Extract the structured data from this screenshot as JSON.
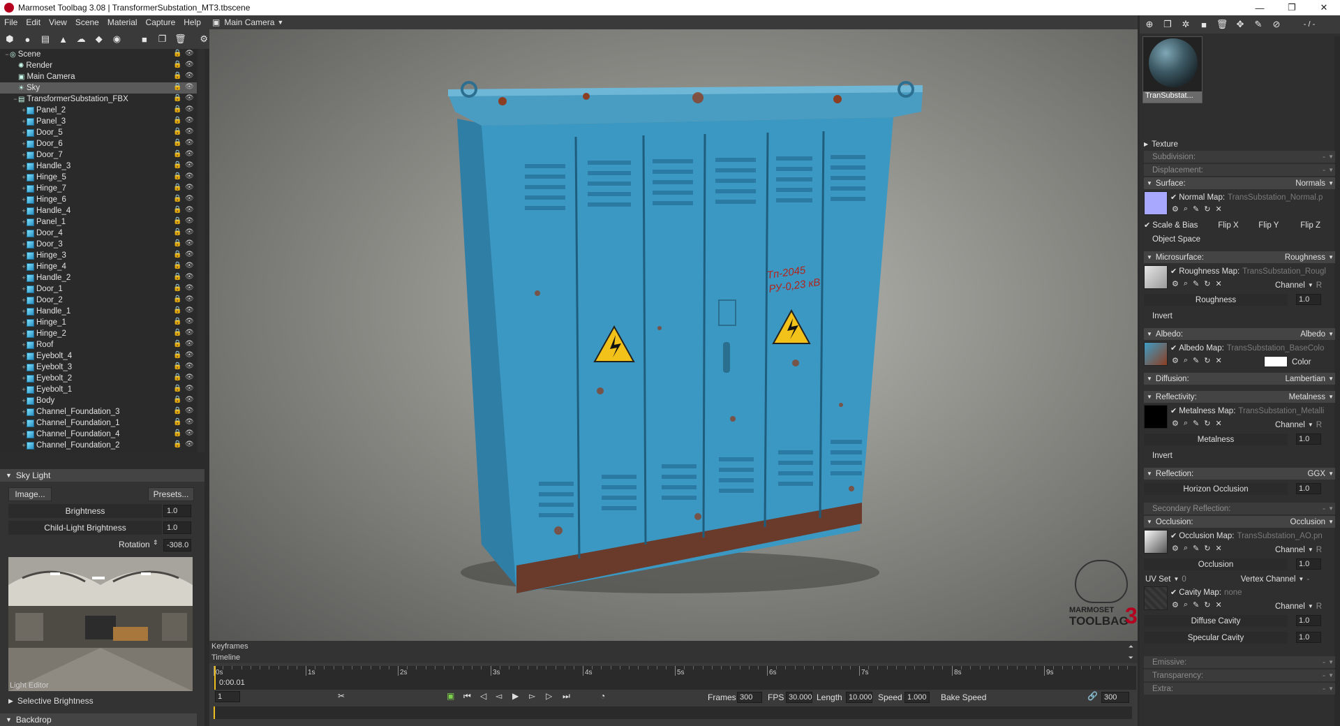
{
  "window": {
    "title": "Marmoset Toolbag 3.08  |  TransformerSubstation_MT3.tbscene",
    "controls": {
      "minimize": "—",
      "maximize": "❐",
      "close": "✕"
    }
  },
  "menu": [
    "File",
    "Edit",
    "View",
    "Scene",
    "Material",
    "Capture",
    "Help"
  ],
  "camera": {
    "label": "Main Camera"
  },
  "scene_tree": {
    "items": [
      {
        "label": "Scene",
        "indent": 0,
        "icon": "scene-icon",
        "expander": "−"
      },
      {
        "label": "Render",
        "indent": 1,
        "icon": "render-icon",
        "expander": ""
      },
      {
        "label": "Main Camera",
        "indent": 1,
        "icon": "camera-icon",
        "expander": ""
      },
      {
        "label": "Sky",
        "indent": 1,
        "icon": "sky-icon",
        "expander": "",
        "selected": true
      },
      {
        "label": "TransformerSubstation_FBX",
        "indent": 1,
        "icon": "file-icon",
        "expander": "−"
      },
      {
        "label": "Panel_2",
        "indent": 2,
        "icon": "mesh-icon",
        "expander": "+"
      },
      {
        "label": "Panel_3",
        "indent": 2,
        "icon": "mesh-icon",
        "expander": "+"
      },
      {
        "label": "Door_5",
        "indent": 2,
        "icon": "mesh-icon",
        "expander": "+"
      },
      {
        "label": "Door_6",
        "indent": 2,
        "icon": "mesh-icon",
        "expander": "+"
      },
      {
        "label": "Door_7",
        "indent": 2,
        "icon": "mesh-icon",
        "expander": "+"
      },
      {
        "label": "Handle_3",
        "indent": 2,
        "icon": "mesh-icon",
        "expander": "+"
      },
      {
        "label": "Hinge_5",
        "indent": 2,
        "icon": "mesh-icon",
        "expander": "+"
      },
      {
        "label": "Hinge_7",
        "indent": 2,
        "icon": "mesh-icon",
        "expander": "+"
      },
      {
        "label": "Hinge_6",
        "indent": 2,
        "icon": "mesh-icon",
        "expander": "+"
      },
      {
        "label": "Handle_4",
        "indent": 2,
        "icon": "mesh-icon",
        "expander": "+"
      },
      {
        "label": "Panel_1",
        "indent": 2,
        "icon": "mesh-icon",
        "expander": "+"
      },
      {
        "label": "Door_4",
        "indent": 2,
        "icon": "mesh-icon",
        "expander": "+"
      },
      {
        "label": "Door_3",
        "indent": 2,
        "icon": "mesh-icon",
        "expander": "+"
      },
      {
        "label": "Hinge_3",
        "indent": 2,
        "icon": "mesh-icon",
        "expander": "+"
      },
      {
        "label": "Hinge_4",
        "indent": 2,
        "icon": "mesh-icon",
        "expander": "+"
      },
      {
        "label": "Handle_2",
        "indent": 2,
        "icon": "mesh-icon",
        "expander": "+"
      },
      {
        "label": "Door_1",
        "indent": 2,
        "icon": "mesh-icon",
        "expander": "+"
      },
      {
        "label": "Door_2",
        "indent": 2,
        "icon": "mesh-icon",
        "expander": "+"
      },
      {
        "label": "Handle_1",
        "indent": 2,
        "icon": "mesh-icon",
        "expander": "+"
      },
      {
        "label": "Hinge_1",
        "indent": 2,
        "icon": "mesh-icon",
        "expander": "+"
      },
      {
        "label": "Hinge_2",
        "indent": 2,
        "icon": "mesh-icon",
        "expander": "+"
      },
      {
        "label": "Roof",
        "indent": 2,
        "icon": "mesh-icon",
        "expander": "+"
      },
      {
        "label": "Eyebolt_4",
        "indent": 2,
        "icon": "mesh-icon",
        "expander": "+"
      },
      {
        "label": "Eyebolt_3",
        "indent": 2,
        "icon": "mesh-icon",
        "expander": "+"
      },
      {
        "label": "Eyebolt_2",
        "indent": 2,
        "icon": "mesh-icon",
        "expander": "+"
      },
      {
        "label": "Eyebolt_1",
        "indent": 2,
        "icon": "mesh-icon",
        "expander": "+"
      },
      {
        "label": "Body",
        "indent": 2,
        "icon": "mesh-icon",
        "expander": "+"
      },
      {
        "label": "Channel_Foundation_3",
        "indent": 2,
        "icon": "mesh-icon",
        "expander": "+"
      },
      {
        "label": "Channel_Foundation_1",
        "indent": 2,
        "icon": "mesh-icon",
        "expander": "+"
      },
      {
        "label": "Channel_Foundation_4",
        "indent": 2,
        "icon": "mesh-icon",
        "expander": "+"
      },
      {
        "label": "Channel_Foundation_2",
        "indent": 2,
        "icon": "mesh-icon",
        "expander": "+"
      }
    ]
  },
  "light_editor": {
    "section_title": "Sky Light",
    "image_button": "Image...",
    "presets_button": "Presets...",
    "brightness_label": "Brightness",
    "brightness_value": "1.0",
    "child_brightness_label": "Child-Light Brightness",
    "child_brightness_value": "1.0",
    "rotation_label": "Rotation",
    "rotation_value": "-308.0",
    "preview_caption": "Light Editor",
    "selective_brightness": "Selective Brightness",
    "backdrop": "Backdrop"
  },
  "viewport": {
    "signage_line1": "Tп-2045",
    "signage_line2": "РУ-0,23 кВ",
    "watermark_line1": "MARMOSET",
    "watermark_line2": "TOOLBAG",
    "watermark_number": "3"
  },
  "timeline": {
    "keyframes_label": "Keyframes",
    "timeline_label": "Timeline",
    "current_time": "0:00.01",
    "ticks": [
      "0s",
      "1s",
      "2s",
      "3s",
      "4s",
      "5s",
      "6s",
      "7s",
      "8s",
      "9s"
    ],
    "current_frame": "1",
    "frames_label": "Frames",
    "frames_value": "300",
    "fps_label": "FPS",
    "fps_value": "30.000",
    "length_label": "Length",
    "length_value": "10.000",
    "speed_label": "Speed",
    "speed_value": "1.000",
    "bake_speed": "Bake Speed",
    "end_frame": "300"
  },
  "material": {
    "name": "TranSubstat...",
    "texture": "Texture",
    "subdivision": "Subdivision:",
    "displacement": "Displacement:",
    "dash": "-",
    "surface": {
      "label": "Surface:",
      "mode": "Normals",
      "map_label": "Normal Map:",
      "map_name": "TransSubstation_Normal.p",
      "scale_bias": "Scale & Bias",
      "flip_x": "Flip X",
      "flip_y": "Flip Y",
      "flip_z": "Flip Z",
      "object_space": "Object Space"
    },
    "microsurface": {
      "label": "Microsurface:",
      "mode": "Roughness",
      "map_label": "Roughness Map:",
      "map_name": "TransSubstation_Rougl",
      "channel_label": "Channel",
      "channel": "R",
      "slider_label": "Roughness",
      "slider_value": "1.0",
      "invert": "Invert"
    },
    "albedo": {
      "label": "Albedo:",
      "mode": "Albedo",
      "map_label": "Albedo Map:",
      "map_name": "TransSubstation_BaseColo",
      "color_label": "Color"
    },
    "diffusion": {
      "label": "Diffusion:",
      "mode": "Lambertian"
    },
    "reflectivity": {
      "label": "Reflectivity:",
      "mode": "Metalness",
      "map_label": "Metalness Map:",
      "map_name": "TransSubstation_Metalli",
      "channel_label": "Channel",
      "channel": "R",
      "slider_label": "Metalness",
      "slider_value": "1.0",
      "invert": "Invert"
    },
    "reflection": {
      "label": "Reflection:",
      "mode": "GGX",
      "slider_label": "Horizon Occlusion",
      "slider_value": "1.0"
    },
    "secondary_reflection": "Secondary Reflection:",
    "occlusion": {
      "label": "Occlusion:",
      "mode": "Occlusion",
      "map_label": "Occlusion Map:",
      "map_name": "TransSubstation_AO.pn",
      "channel_label": "Channel",
      "channel": "R",
      "slider_label": "Occlusion",
      "slider_value": "1.0",
      "uvset_label": "UV Set",
      "uvset_value": "0",
      "vertex_channel": "Vertex Channel",
      "vertex_value": "-",
      "cavity_label": "Cavity Map:",
      "cavity_name": "none",
      "cavity_channel": "R",
      "diffuse_cavity": "Diffuse Cavity",
      "diffuse_cavity_value": "1.0",
      "specular_cavity": "Specular Cavity",
      "specular_cavity_value": "1.0"
    },
    "emissive": "Emissive:",
    "transparency": "Transparency:",
    "extra": "Extra:",
    "top_right_value": "- / -"
  },
  "colors": {
    "cabinet": "#3f9cc4",
    "rust": "#8b3e22",
    "warning_yellow": "#f2c21a",
    "panel_bg": "#2f2f2f"
  }
}
